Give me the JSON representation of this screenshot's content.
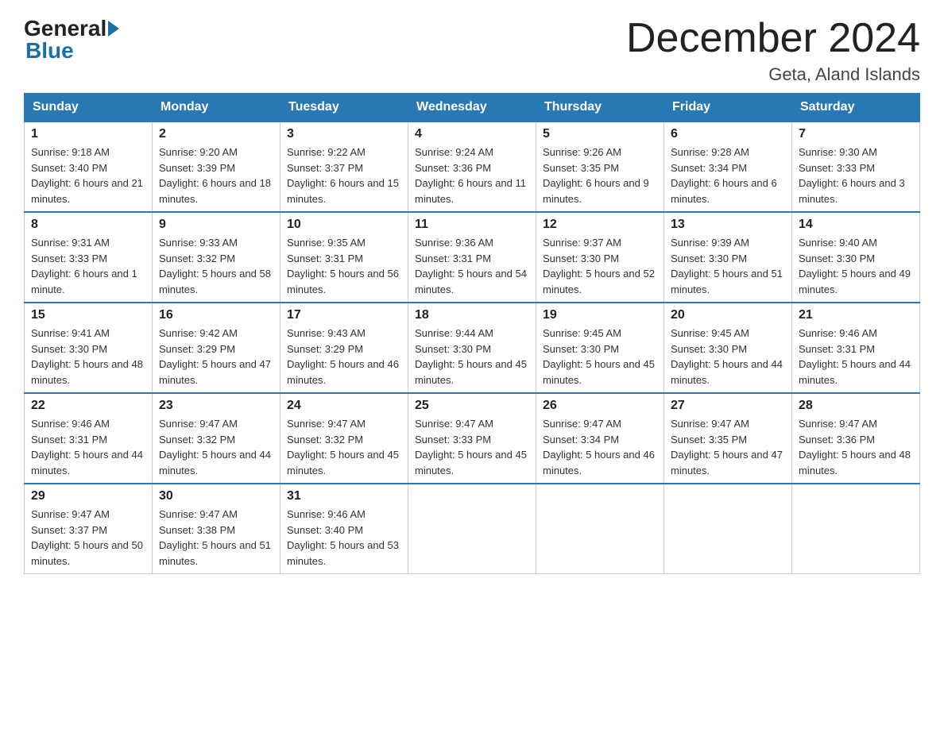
{
  "logo": {
    "general": "General",
    "blue": "Blue"
  },
  "title": "December 2024",
  "location": "Geta, Aland Islands",
  "days_of_week": [
    "Sunday",
    "Monday",
    "Tuesday",
    "Wednesday",
    "Thursday",
    "Friday",
    "Saturday"
  ],
  "weeks": [
    [
      {
        "day": "1",
        "sunrise": "Sunrise: 9:18 AM",
        "sunset": "Sunset: 3:40 PM",
        "daylight": "Daylight: 6 hours and 21 minutes."
      },
      {
        "day": "2",
        "sunrise": "Sunrise: 9:20 AM",
        "sunset": "Sunset: 3:39 PM",
        "daylight": "Daylight: 6 hours and 18 minutes."
      },
      {
        "day": "3",
        "sunrise": "Sunrise: 9:22 AM",
        "sunset": "Sunset: 3:37 PM",
        "daylight": "Daylight: 6 hours and 15 minutes."
      },
      {
        "day": "4",
        "sunrise": "Sunrise: 9:24 AM",
        "sunset": "Sunset: 3:36 PM",
        "daylight": "Daylight: 6 hours and 11 minutes."
      },
      {
        "day": "5",
        "sunrise": "Sunrise: 9:26 AM",
        "sunset": "Sunset: 3:35 PM",
        "daylight": "Daylight: 6 hours and 9 minutes."
      },
      {
        "day": "6",
        "sunrise": "Sunrise: 9:28 AM",
        "sunset": "Sunset: 3:34 PM",
        "daylight": "Daylight: 6 hours and 6 minutes."
      },
      {
        "day": "7",
        "sunrise": "Sunrise: 9:30 AM",
        "sunset": "Sunset: 3:33 PM",
        "daylight": "Daylight: 6 hours and 3 minutes."
      }
    ],
    [
      {
        "day": "8",
        "sunrise": "Sunrise: 9:31 AM",
        "sunset": "Sunset: 3:33 PM",
        "daylight": "Daylight: 6 hours and 1 minute."
      },
      {
        "day": "9",
        "sunrise": "Sunrise: 9:33 AM",
        "sunset": "Sunset: 3:32 PM",
        "daylight": "Daylight: 5 hours and 58 minutes."
      },
      {
        "day": "10",
        "sunrise": "Sunrise: 9:35 AM",
        "sunset": "Sunset: 3:31 PM",
        "daylight": "Daylight: 5 hours and 56 minutes."
      },
      {
        "day": "11",
        "sunrise": "Sunrise: 9:36 AM",
        "sunset": "Sunset: 3:31 PM",
        "daylight": "Daylight: 5 hours and 54 minutes."
      },
      {
        "day": "12",
        "sunrise": "Sunrise: 9:37 AM",
        "sunset": "Sunset: 3:30 PM",
        "daylight": "Daylight: 5 hours and 52 minutes."
      },
      {
        "day": "13",
        "sunrise": "Sunrise: 9:39 AM",
        "sunset": "Sunset: 3:30 PM",
        "daylight": "Daylight: 5 hours and 51 minutes."
      },
      {
        "day": "14",
        "sunrise": "Sunrise: 9:40 AM",
        "sunset": "Sunset: 3:30 PM",
        "daylight": "Daylight: 5 hours and 49 minutes."
      }
    ],
    [
      {
        "day": "15",
        "sunrise": "Sunrise: 9:41 AM",
        "sunset": "Sunset: 3:30 PM",
        "daylight": "Daylight: 5 hours and 48 minutes."
      },
      {
        "day": "16",
        "sunrise": "Sunrise: 9:42 AM",
        "sunset": "Sunset: 3:29 PM",
        "daylight": "Daylight: 5 hours and 47 minutes."
      },
      {
        "day": "17",
        "sunrise": "Sunrise: 9:43 AM",
        "sunset": "Sunset: 3:29 PM",
        "daylight": "Daylight: 5 hours and 46 minutes."
      },
      {
        "day": "18",
        "sunrise": "Sunrise: 9:44 AM",
        "sunset": "Sunset: 3:30 PM",
        "daylight": "Daylight: 5 hours and 45 minutes."
      },
      {
        "day": "19",
        "sunrise": "Sunrise: 9:45 AM",
        "sunset": "Sunset: 3:30 PM",
        "daylight": "Daylight: 5 hours and 45 minutes."
      },
      {
        "day": "20",
        "sunrise": "Sunrise: 9:45 AM",
        "sunset": "Sunset: 3:30 PM",
        "daylight": "Daylight: 5 hours and 44 minutes."
      },
      {
        "day": "21",
        "sunrise": "Sunrise: 9:46 AM",
        "sunset": "Sunset: 3:31 PM",
        "daylight": "Daylight: 5 hours and 44 minutes."
      }
    ],
    [
      {
        "day": "22",
        "sunrise": "Sunrise: 9:46 AM",
        "sunset": "Sunset: 3:31 PM",
        "daylight": "Daylight: 5 hours and 44 minutes."
      },
      {
        "day": "23",
        "sunrise": "Sunrise: 9:47 AM",
        "sunset": "Sunset: 3:32 PM",
        "daylight": "Daylight: 5 hours and 44 minutes."
      },
      {
        "day": "24",
        "sunrise": "Sunrise: 9:47 AM",
        "sunset": "Sunset: 3:32 PM",
        "daylight": "Daylight: 5 hours and 45 minutes."
      },
      {
        "day": "25",
        "sunrise": "Sunrise: 9:47 AM",
        "sunset": "Sunset: 3:33 PM",
        "daylight": "Daylight: 5 hours and 45 minutes."
      },
      {
        "day": "26",
        "sunrise": "Sunrise: 9:47 AM",
        "sunset": "Sunset: 3:34 PM",
        "daylight": "Daylight: 5 hours and 46 minutes."
      },
      {
        "day": "27",
        "sunrise": "Sunrise: 9:47 AM",
        "sunset": "Sunset: 3:35 PM",
        "daylight": "Daylight: 5 hours and 47 minutes."
      },
      {
        "day": "28",
        "sunrise": "Sunrise: 9:47 AM",
        "sunset": "Sunset: 3:36 PM",
        "daylight": "Daylight: 5 hours and 48 minutes."
      }
    ],
    [
      {
        "day": "29",
        "sunrise": "Sunrise: 9:47 AM",
        "sunset": "Sunset: 3:37 PM",
        "daylight": "Daylight: 5 hours and 50 minutes."
      },
      {
        "day": "30",
        "sunrise": "Sunrise: 9:47 AM",
        "sunset": "Sunset: 3:38 PM",
        "daylight": "Daylight: 5 hours and 51 minutes."
      },
      {
        "day": "31",
        "sunrise": "Sunrise: 9:46 AM",
        "sunset": "Sunset: 3:40 PM",
        "daylight": "Daylight: 5 hours and 53 minutes."
      },
      null,
      null,
      null,
      null
    ]
  ]
}
